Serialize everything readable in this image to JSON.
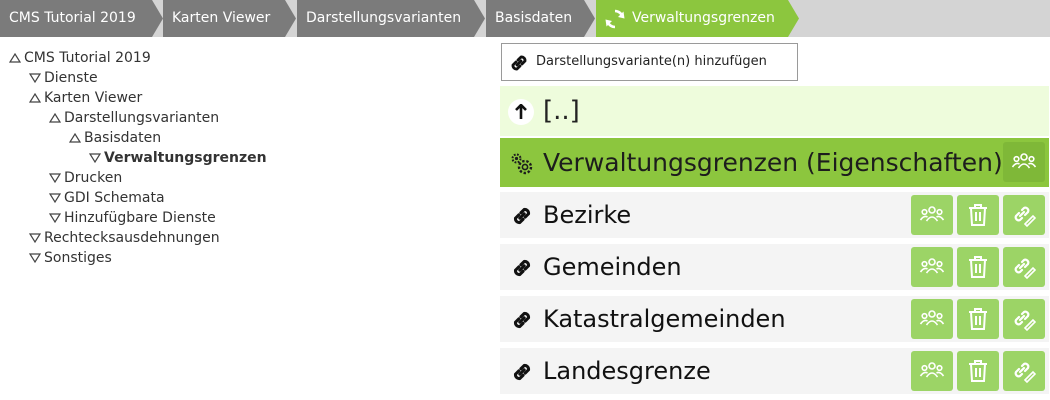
{
  "breadcrumb": [
    {
      "label": "CMS Tutorial 2019"
    },
    {
      "label": "Karten Viewer"
    },
    {
      "label": "Darstellungsvarianten"
    },
    {
      "label": "Basisdaten"
    },
    {
      "label": "Verwaltungsgrenzen",
      "active": true,
      "icon": "refresh-icon"
    }
  ],
  "tree": [
    {
      "label": "CMS Tutorial 2019",
      "state": "expanded"
    },
    {
      "label": "Dienste",
      "state": "collapsed"
    },
    {
      "label": "Karten Viewer",
      "state": "expanded"
    },
    {
      "label": "Darstellungsvarianten",
      "state": "expanded"
    },
    {
      "label": "Basisdaten",
      "state": "expanded"
    },
    {
      "label": "Verwaltungsgrenzen",
      "state": "collapsed",
      "selected": true
    },
    {
      "label": "Drucken",
      "state": "collapsed"
    },
    {
      "label": "GDI Schemata",
      "state": "collapsed"
    },
    {
      "label": "Hinzufügbare Dienste",
      "state": "collapsed"
    },
    {
      "label": "Rechtecksausdehnungen",
      "state": "collapsed"
    },
    {
      "label": "Sonstiges",
      "state": "collapsed"
    }
  ],
  "panel": {
    "add_button_label": "Darstellungsvariante(n) hinzufügen",
    "up_label": "[..]",
    "properties_label": "Verwaltungsgrenzen (Eigenschaften)",
    "items": [
      {
        "label": "Bezirke"
      },
      {
        "label": "Gemeinden"
      },
      {
        "label": "Katastralgemeinden"
      },
      {
        "label": "Landesgrenze"
      }
    ]
  },
  "colors": {
    "accent_green": "#8cc63e",
    "button_green": "#9cd466",
    "crumb_gray": "#7b7b7b",
    "up_row_bg": "#eefcdc"
  }
}
